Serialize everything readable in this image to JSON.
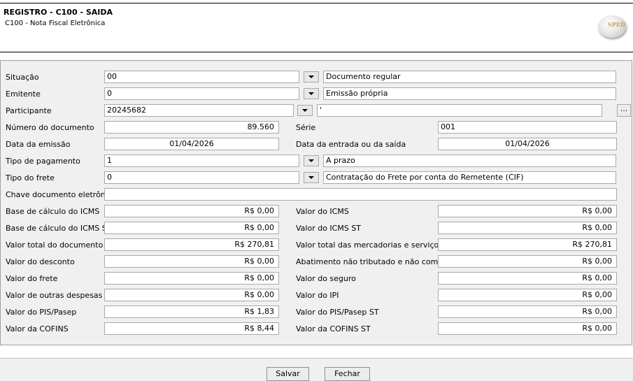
{
  "header": {
    "title": "REGISTRO - C100 - SAIDA",
    "subtitle": "C100 - Nota Fiscal Eletrônica"
  },
  "form": {
    "situacao": {
      "label": "Situação",
      "code": "00",
      "description": "Documento regular"
    },
    "emitente": {
      "label": "Emitente",
      "code": "0",
      "description": "Emissão própria"
    },
    "participante": {
      "label": "Participante",
      "code": "20245682",
      "description": "'",
      "lookup_label": "..."
    },
    "numero_documento": {
      "label": "Número do documento",
      "value": "89.560"
    },
    "serie": {
      "label": "Série",
      "value": "001"
    },
    "data_emissao": {
      "label": "Data da emissão",
      "value": "01/04/2026"
    },
    "data_entrada_saida": {
      "label": "Data da entrada ou da saída",
      "value": "01/04/2026"
    },
    "tipo_pagamento": {
      "label": "Tipo de pagamento",
      "code": "1",
      "description": "A prazo"
    },
    "tipo_frete": {
      "label": "Tipo do frete",
      "code": "0",
      "description": "Contratação do Frete por conta do Remetente (CIF)"
    },
    "chave": {
      "label": "Chave documento eletrônico",
      "value": ""
    },
    "base_icms": {
      "label": "Base de cálculo do ICMS",
      "value": "R$ 0,00"
    },
    "valor_icms": {
      "label": "Valor do ICMS",
      "value": "R$ 0,00"
    },
    "base_icms_st": {
      "label": "Base de cálculo do ICMS ST",
      "value": "R$ 0,00"
    },
    "valor_icms_st": {
      "label": "Valor do ICMS ST",
      "value": "R$ 0,00"
    },
    "valor_total_documento": {
      "label": "Valor total do documento",
      "value": "R$ 270,81"
    },
    "valor_total_mercadorias": {
      "label": "Valor total das mercadorias e serviços",
      "value": "R$ 270,81"
    },
    "valor_desconto": {
      "label": "Valor do desconto",
      "value": "R$ 0,00"
    },
    "abatimento": {
      "label": "Abatimento não tributado e não comercial",
      "value": "R$ 0,00"
    },
    "valor_frete": {
      "label": "Valor do frete",
      "value": "R$ 0,00"
    },
    "valor_seguro": {
      "label": "Valor do seguro",
      "value": "R$ 0,00"
    },
    "valor_outras_despesas": {
      "label": "Valor de outras despesas",
      "value": "R$ 0,00"
    },
    "valor_ipi": {
      "label": "Valor do IPI",
      "value": "R$ 0,00"
    },
    "valor_pis": {
      "label": "Valor do PIS/Pasep",
      "value": "R$ 1,83"
    },
    "valor_pis_st": {
      "label": "Valor do PIS/Pasep ST",
      "value": "R$ 0,00"
    },
    "valor_cofins": {
      "label": "Valor da COFINS",
      "value": "R$ 8,44"
    },
    "valor_cofins_st": {
      "label": "Valor da COFINS ST",
      "value": "R$ 0,00"
    }
  },
  "footer": {
    "save_label": "Salvar",
    "close_label": "Fechar"
  }
}
